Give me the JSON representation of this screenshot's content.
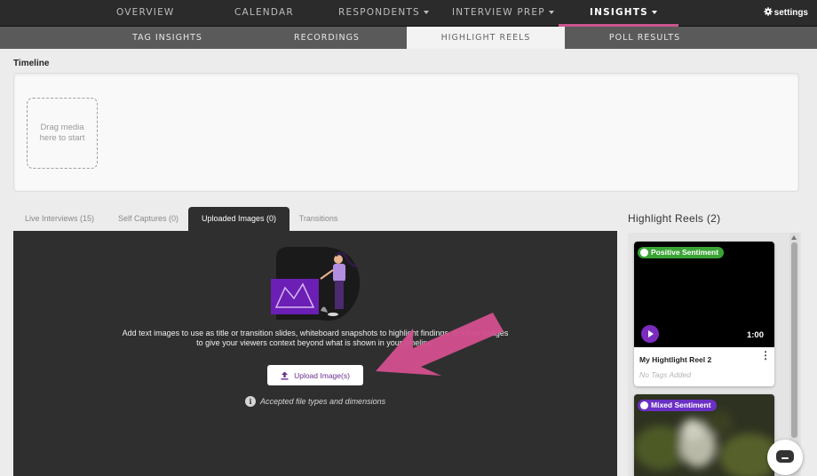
{
  "nav": {
    "items": [
      {
        "label": "OVERVIEW"
      },
      {
        "label": "CALENDAR"
      },
      {
        "label": "RESPONDENTS"
      },
      {
        "label": "INTERVIEW PREP"
      },
      {
        "label": "INSIGHTS"
      }
    ],
    "settings_label": "settings",
    "accent_color": "#c9558f"
  },
  "subnav": {
    "items": [
      {
        "label": "TAG INSIGHTS"
      },
      {
        "label": "RECORDINGS"
      },
      {
        "label": "HIGHLIGHT REELS"
      },
      {
        "label": "POLL RESULTS"
      }
    ]
  },
  "timeline": {
    "label": "Timeline",
    "drop_text": "Drag media here to start"
  },
  "media_tabs": [
    {
      "label": "Live Interviews (15)"
    },
    {
      "label": "Self Captures (0)"
    },
    {
      "label": "Uploaded Images (0)"
    },
    {
      "label": "Transitions"
    }
  ],
  "uploaded": {
    "helper_text": "Add text images to use as title or transition slides, whiteboard snapshots to highlight findings, or other images to give your viewers context beyond what is shown in your timeline.",
    "upload_button": "Upload Image(s)",
    "accepted_text": "Accepted file types and dimensions"
  },
  "reels": {
    "heading": "Highlight Reels (2)",
    "cards": [
      {
        "sentiment": "Positive Sentiment",
        "sentiment_color": "#3aa335",
        "duration": "1:00",
        "title": "My Hightlight Reel 2",
        "tags": "No Tags Added"
      },
      {
        "sentiment": "Mixed Sentiment",
        "sentiment_color": "#6a2fc4"
      }
    ]
  },
  "colors": {
    "play_button": "#7b2cbf",
    "annotation_arrow": "#d14e8e"
  }
}
